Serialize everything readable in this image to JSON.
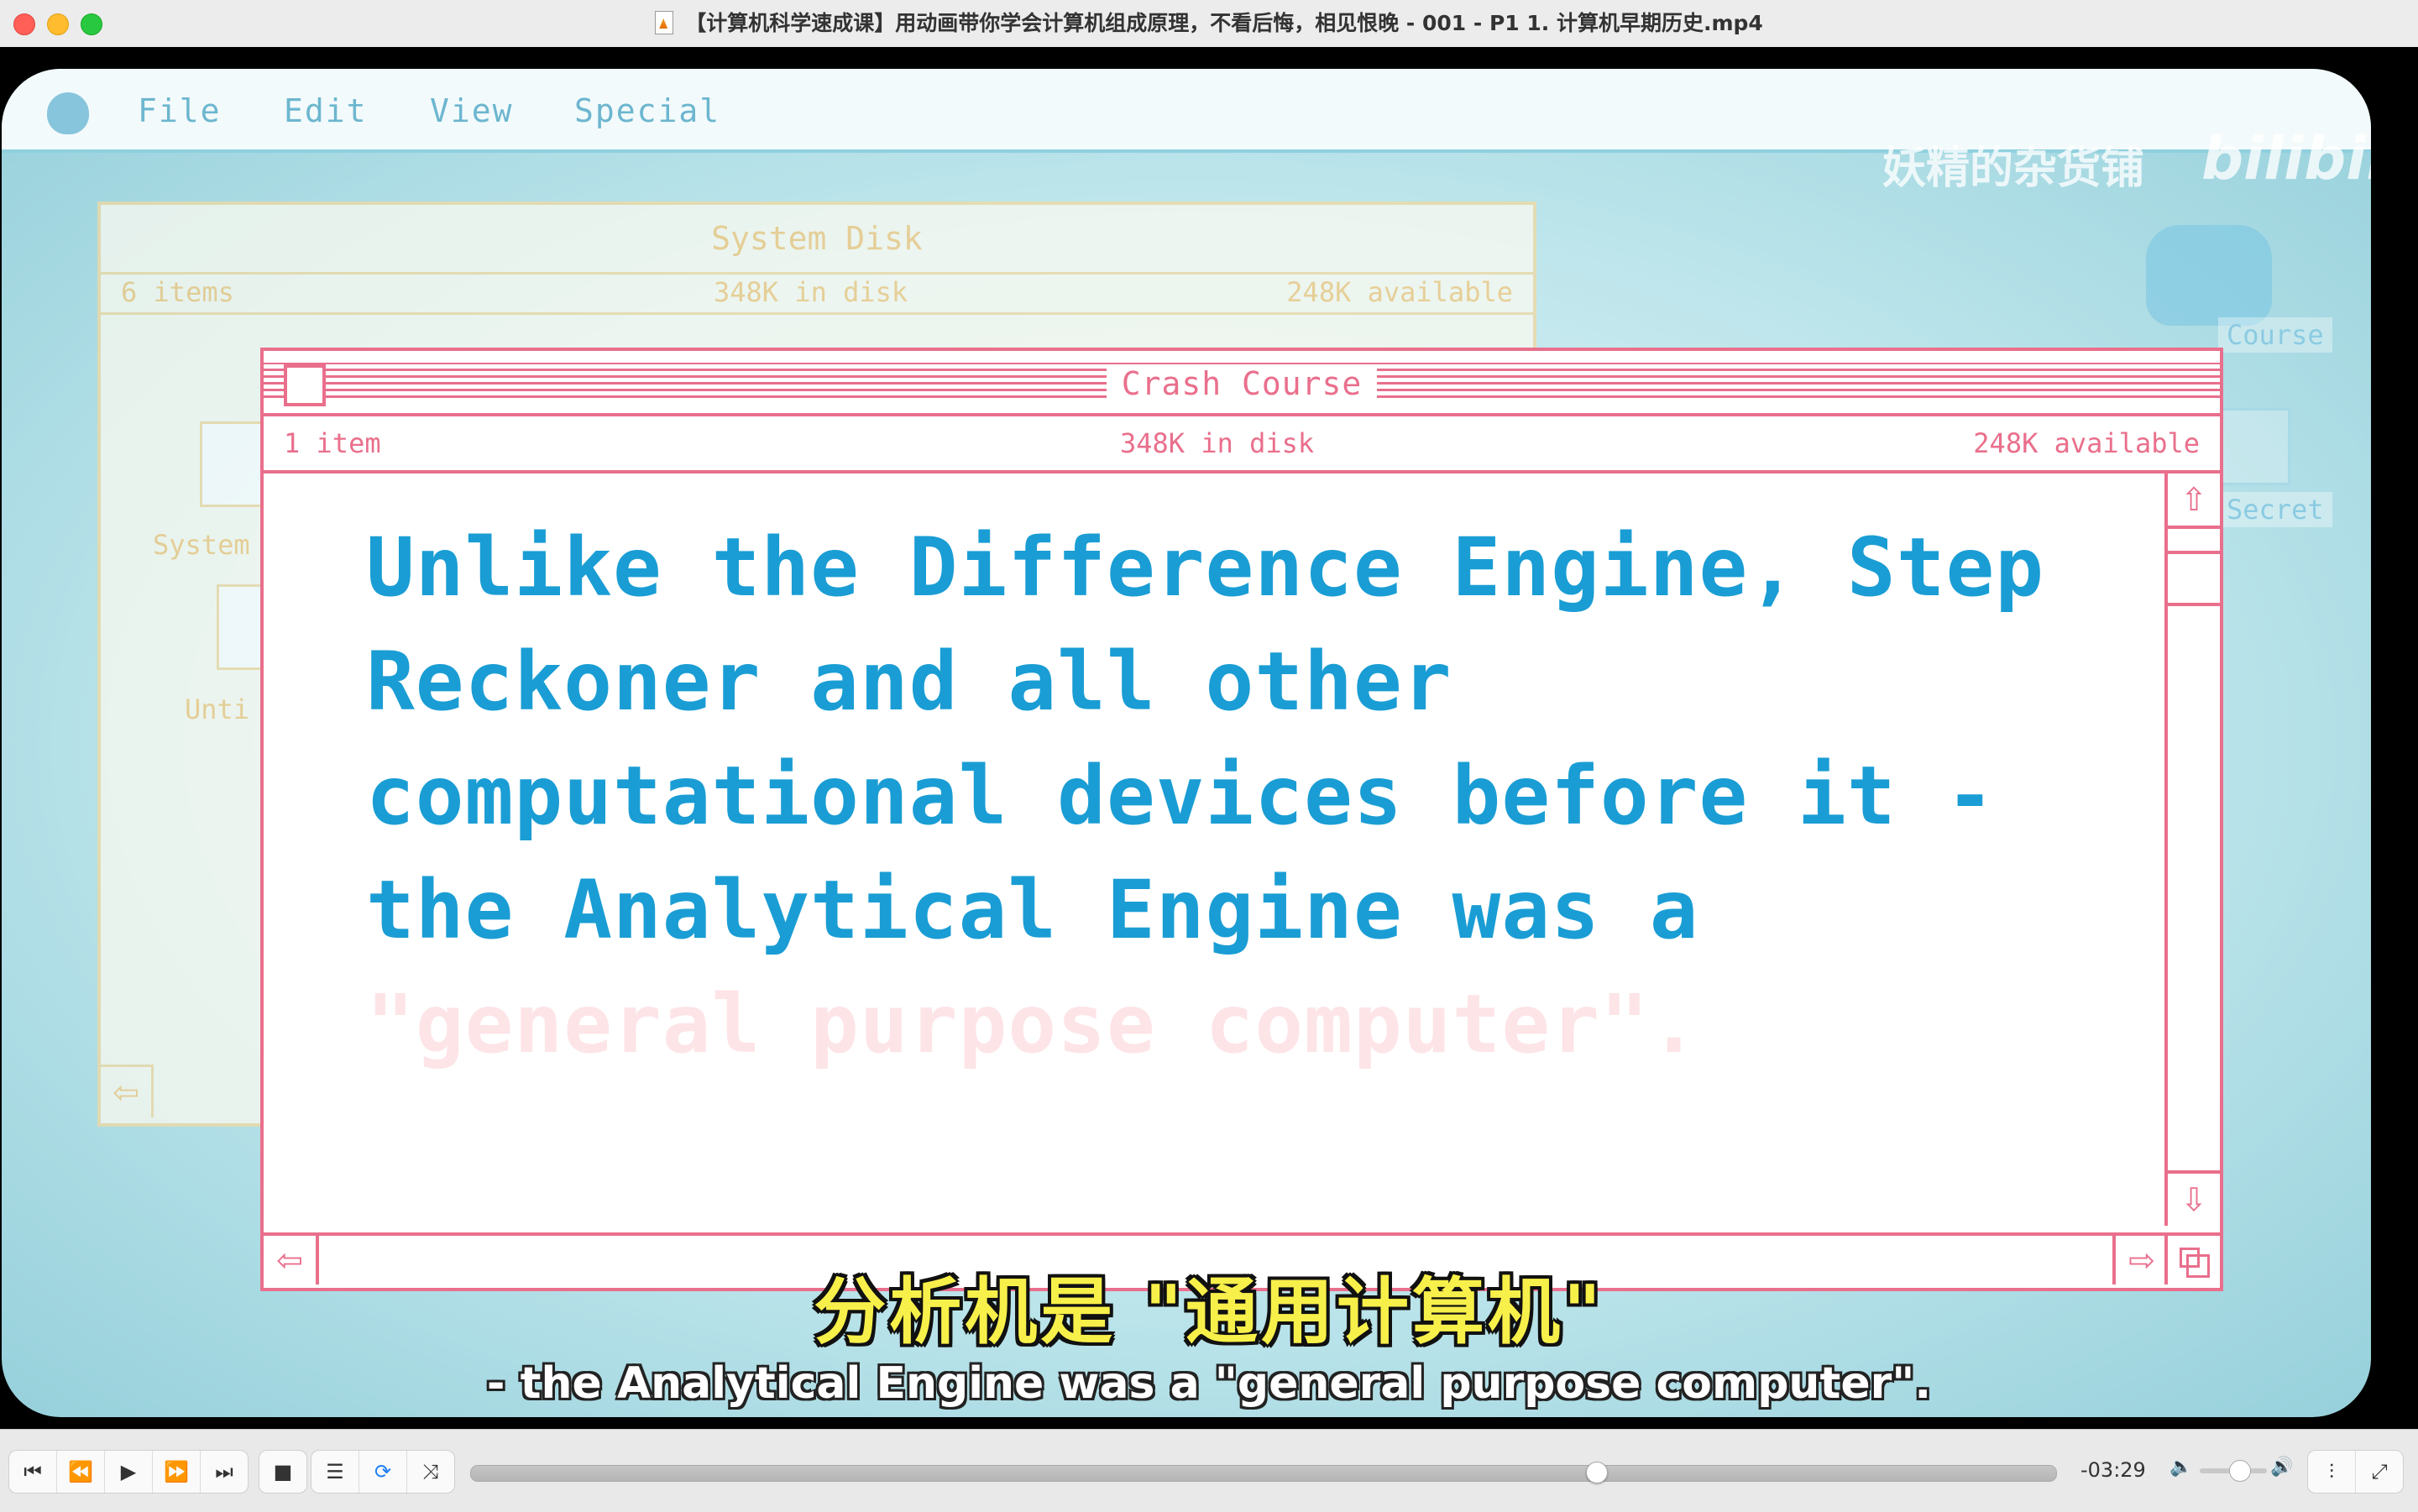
{
  "window": {
    "title": "【计算机科学速成课】用动画带你学会计算机组成原理，不看后悔，相见恨晚 - 001 - P1 1. 计算机早期历史.mp4"
  },
  "retro_desktop": {
    "menu": [
      "File",
      "Edit",
      "View",
      "Special"
    ],
    "watermark": "妖精的杂货铺",
    "watermark_logo": "bilibili",
    "background_window": {
      "title": "System Disk",
      "item_count": "6 items",
      "disk": "348K in disk",
      "available": "248K available",
      "icon_labels": [
        "System",
        "Unti"
      ]
    },
    "desktop_icons": [
      "Course",
      "Secret"
    ],
    "front_window": {
      "title": "Crash Course",
      "item_count": "1 item",
      "disk": "348K in disk",
      "available": "248K available",
      "text_visible": "Unlike the Difference Engine, Step Reckoner and all other computational devices before it - the Analytical Engine was a ",
      "text_faded": "\"general purpose computer\"."
    }
  },
  "subtitles": {
    "chinese": "分析机是 \"通用计算机\"",
    "english": "- the Analytical Engine was a \"general purpose computer\"."
  },
  "player": {
    "time_remaining": "-03:29",
    "progress": 0.71,
    "volume": 0.6,
    "loop_enabled": true,
    "accent_color": "#1d7ff5"
  }
}
